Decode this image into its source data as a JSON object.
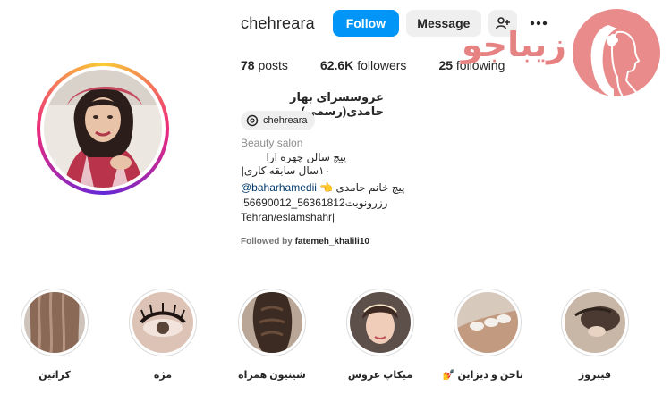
{
  "profile": {
    "username": "chehreara",
    "follow_label": "Follow",
    "message_label": "Message",
    "add_user_icon": "add-user-icon",
    "more_icon": "more-options-icon",
    "full_name": "عروسسرای بهار حامدی(رسمی)",
    "threads_handle": "chehreara",
    "category": "Beauty salon",
    "followed_by_prefix": "Followed by",
    "followed_by_user": "fatemeh_khalili10"
  },
  "stats": [
    {
      "count": "78",
      "label": "posts"
    },
    {
      "count": "62.6K",
      "label": "followers"
    },
    {
      "count": "25",
      "label": "following"
    }
  ],
  "bio": {
    "line1": "پیچ سالن چهره ارا",
    "line2": "۱۰سال سابقه کاری|",
    "line3_text": "پیچ خانم حامدی 👈",
    "line3_link": "@baharhamedii",
    "line4": "رزرونوبت56361812_56690012|",
    "line5": "Tehran/eslamshahr|"
  },
  "watermark": {
    "text": "زیباجو",
    "color": "#e68282"
  },
  "highlights": [
    {
      "label": "فیبروز"
    },
    {
      "label": "ناخن و دیزاین 💅"
    },
    {
      "label": "میکاپ عروس"
    },
    {
      "label": "شینیون همراه"
    },
    {
      "label": "مژه"
    },
    {
      "label": "کراتین"
    }
  ],
  "colors": {
    "follow_button": "#0095f6",
    "secondary_button": "#efefef",
    "link": "#00376b"
  }
}
